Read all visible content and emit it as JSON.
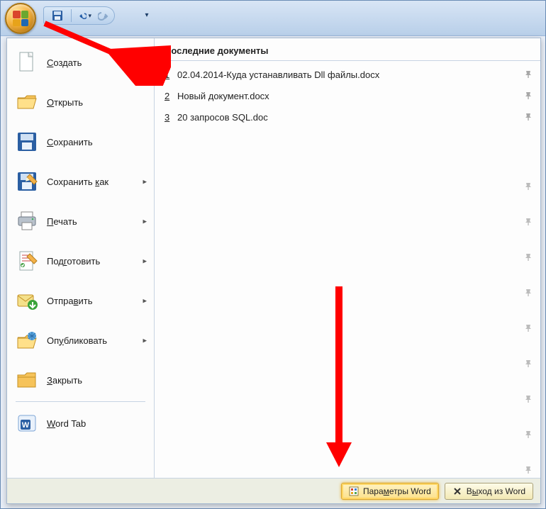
{
  "qat": {
    "save_tip": "Сохранить",
    "undo_tip": "Отменить",
    "redo_tip": "Повторить"
  },
  "menu": {
    "items": [
      {
        "label_pre": "",
        "u": "С",
        "label_post": "оздать",
        "arrow": false,
        "icon": "new"
      },
      {
        "label_pre": "",
        "u": "О",
        "label_post": "ткрыть",
        "arrow": false,
        "icon": "open"
      },
      {
        "label_pre": "",
        "u": "С",
        "label_post": "охранить",
        "arrow": false,
        "icon": "save"
      },
      {
        "label_pre": "Сохранить ",
        "u": "к",
        "label_post": "ак",
        "arrow": true,
        "icon": "saveas"
      },
      {
        "label_pre": "",
        "u": "П",
        "label_post": "ечать",
        "arrow": true,
        "icon": "print"
      },
      {
        "label_pre": "Под",
        "u": "г",
        "label_post": "отовить",
        "arrow": true,
        "icon": "prepare"
      },
      {
        "label_pre": "Отпра",
        "u": "в",
        "label_post": "ить",
        "arrow": true,
        "icon": "send"
      },
      {
        "label_pre": "Оп",
        "u": "у",
        "label_post": "бликовать",
        "arrow": true,
        "icon": "publish"
      },
      {
        "label_pre": "",
        "u": "З",
        "label_post": "акрыть",
        "arrow": false,
        "icon": "close"
      },
      {
        "label_pre": "",
        "u": "W",
        "label_post": "ord Tab",
        "arrow": false,
        "icon": "wordtab",
        "sep_before": true
      }
    ]
  },
  "recent": {
    "header": "Последние документы",
    "docs": [
      {
        "n": "1",
        "name": "02.04.2014-Куда устанавливать Dll файлы.docx"
      },
      {
        "n": "2",
        "name": "Новый документ.docx"
      },
      {
        "n": "3",
        "name": "20 запросов SQL.doc"
      }
    ]
  },
  "bottom": {
    "options_pre": "Пара",
    "options_u": "м",
    "options_post": "етры Word",
    "exit_pre": "В",
    "exit_u": "ы",
    "exit_post": "ход из Word"
  }
}
